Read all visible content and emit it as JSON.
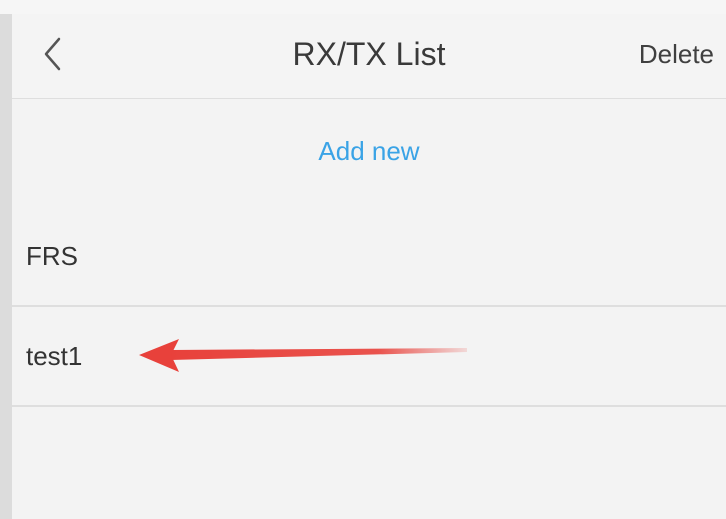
{
  "header": {
    "title": "RX/TX List",
    "delete_label": "Delete",
    "back_icon": "chevron-left-icon"
  },
  "actions": {
    "add_new_label": "Add new"
  },
  "list": {
    "items": [
      {
        "label": "FRS"
      },
      {
        "label": "test1"
      }
    ]
  },
  "annotation": {
    "arrow_color": "#e8413b",
    "arrow_target": "test1"
  },
  "colors": {
    "accent": "#3aa3e6",
    "background": "#f3f3f3",
    "divider": "#dedede",
    "text": "#333333"
  }
}
